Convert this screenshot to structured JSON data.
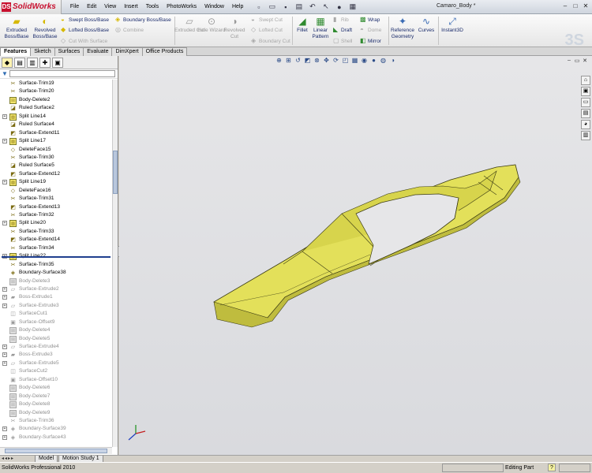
{
  "app": {
    "name": "SolidWorks",
    "logo_letters": "DS",
    "document_title": "Camaro_Body *"
  },
  "menu": [
    "File",
    "Edit",
    "View",
    "Insert",
    "Tools",
    "PhotoWorks",
    "Window",
    "Help"
  ],
  "quick_access_icons": [
    "new-icon",
    "open-icon",
    "save-icon",
    "print-icon",
    "undo-icon",
    "select-icon",
    "rebuild-icon",
    "options-icon"
  ],
  "window_controls": [
    "minimize-icon",
    "maximize-icon",
    "close-icon"
  ],
  "command_manager": {
    "extruded_boss": "Extruded Boss/Base",
    "revolved_boss": "Revolved Boss/Base",
    "swept_boss": "Swept Boss/Base",
    "lofted_boss": "Lofted Boss/Base",
    "boundary_boss": "Boundary Boss/Base",
    "cut_with_surface": "Cut With Surface",
    "combine": "Combine",
    "extruded_cut": "Extruded Cut",
    "hole_wizard": "Hole Wizard",
    "revolved_cut": "Revolved Cut",
    "swept_cut": "Swept Cut",
    "lofted_cut": "Lofted Cut",
    "boundary_cut": "Boundary Cut",
    "fillet": "Fillet",
    "linear_pattern": "Linear Pattern",
    "rib": "Rib",
    "draft": "Draft",
    "shell": "Shell",
    "wrap": "Wrap",
    "dome": "Dome",
    "mirror": "Mirror",
    "reference_geometry": "Reference Geometry",
    "curves": "Curves",
    "instant3d": "Instant3D"
  },
  "command_tabs": [
    "Features",
    "Sketch",
    "Surfaces",
    "Evaluate",
    "DimXpert",
    "Office Products"
  ],
  "active_command_tab": "Features",
  "feature_tree": {
    "active": [
      {
        "label": "Surface-Trim19",
        "icon": "surface-trim-icon",
        "expand": false
      },
      {
        "label": "Surface-Trim20",
        "icon": "surface-trim-icon",
        "expand": false
      },
      {
        "label": "Body-Delete2",
        "icon": "body-delete-icon",
        "expand": false
      },
      {
        "label": "Ruled Surface2",
        "icon": "ruled-surface-icon",
        "expand": false
      },
      {
        "label": "Split Line14",
        "icon": "split-line-icon",
        "expand": true
      },
      {
        "label": "Ruled Surface4",
        "icon": "ruled-surface-icon",
        "expand": false
      },
      {
        "label": "Surface-Extend11",
        "icon": "surface-extend-icon",
        "expand": false
      },
      {
        "label": "Split Line17",
        "icon": "split-line-icon",
        "expand": true
      },
      {
        "label": "DeleteFace15",
        "icon": "delete-face-icon",
        "expand": false
      },
      {
        "label": "Surface-Trim30",
        "icon": "surface-trim-icon",
        "expand": false
      },
      {
        "label": "Ruled Surface5",
        "icon": "ruled-surface-icon",
        "expand": false
      },
      {
        "label": "Surface-Extend12",
        "icon": "surface-extend-icon",
        "expand": false
      },
      {
        "label": "Split Line19",
        "icon": "split-line-icon",
        "expand": true
      },
      {
        "label": "DeleteFace16",
        "icon": "delete-face-icon",
        "expand": false
      },
      {
        "label": "Surface-Trim31",
        "icon": "surface-trim-icon",
        "expand": false
      },
      {
        "label": "Surface-Extend13",
        "icon": "surface-extend-icon",
        "expand": false
      },
      {
        "label": "Surface-Trim32",
        "icon": "surface-trim-icon",
        "expand": false
      },
      {
        "label": "Split Line20",
        "icon": "split-line-icon",
        "expand": true
      },
      {
        "label": "Surface-Trim33",
        "icon": "surface-trim-icon",
        "expand": false
      },
      {
        "label": "Surface-Extend14",
        "icon": "surface-extend-icon",
        "expand": false
      },
      {
        "label": "Surface-Trim34",
        "icon": "surface-trim-icon",
        "expand": false
      },
      {
        "label": "Split Line22",
        "icon": "split-line-icon",
        "expand": true
      },
      {
        "label": "Surface-Trim35",
        "icon": "surface-trim-icon",
        "expand": false
      },
      {
        "label": "Boundary-Surface38",
        "icon": "boundary-surface-icon",
        "expand": false
      }
    ],
    "suppressed": [
      {
        "label": "Body-Delete3",
        "icon": "body-delete-icon",
        "expand": false
      },
      {
        "label": "Surface-Extrude2",
        "icon": "surface-extrude-icon",
        "expand": true
      },
      {
        "label": "Boss-Extrude1",
        "icon": "boss-extrude-icon",
        "expand": true
      },
      {
        "label": "Surface-Extrude3",
        "icon": "surface-extrude-icon",
        "expand": true
      },
      {
        "label": "SurfaceCut1",
        "icon": "surface-cut-icon",
        "expand": false
      },
      {
        "label": "Surface-Offset9",
        "icon": "surface-offset-icon",
        "expand": false
      },
      {
        "label": "Body-Delete4",
        "icon": "body-delete-icon",
        "expand": false
      },
      {
        "label": "Body-Delete5",
        "icon": "body-delete-icon",
        "expand": false
      },
      {
        "label": "Surface-Extrude4",
        "icon": "surface-extrude-icon",
        "expand": true
      },
      {
        "label": "Boss-Extrude3",
        "icon": "boss-extrude-icon",
        "expand": true
      },
      {
        "label": "Surface-Extrude5",
        "icon": "surface-extrude-icon",
        "expand": true
      },
      {
        "label": "SurfaceCut2",
        "icon": "surface-cut-icon",
        "expand": false
      },
      {
        "label": "Surface-Offset10",
        "icon": "surface-offset-icon",
        "expand": false
      },
      {
        "label": "Body-Delete6",
        "icon": "body-delete-icon",
        "expand": false
      },
      {
        "label": "Body-Delete7",
        "icon": "body-delete-icon",
        "expand": false
      },
      {
        "label": "Body-Delete8",
        "icon": "body-delete-icon",
        "expand": false
      },
      {
        "label": "Body-Delete9",
        "icon": "body-delete-icon",
        "expand": false
      },
      {
        "label": "Surface-Trim36",
        "icon": "surface-trim-icon",
        "expand": false
      },
      {
        "label": "Boundary-Surface39",
        "icon": "boundary-surface-icon",
        "expand": true
      },
      {
        "label": "Boundary-Surface43",
        "icon": "boundary-surface-icon",
        "expand": true
      }
    ]
  },
  "bottom_tabs": [
    "Model",
    "Motion Study 1"
  ],
  "status": {
    "app_version": "SolidWorks Professional 2010",
    "mode": "Editing Part",
    "help": "?"
  },
  "colors": {
    "model_fill": "#e3e05a",
    "model_edge": "#3a3a14",
    "background_top": "#e6e6e8",
    "background_bottom": "#d9dade"
  }
}
